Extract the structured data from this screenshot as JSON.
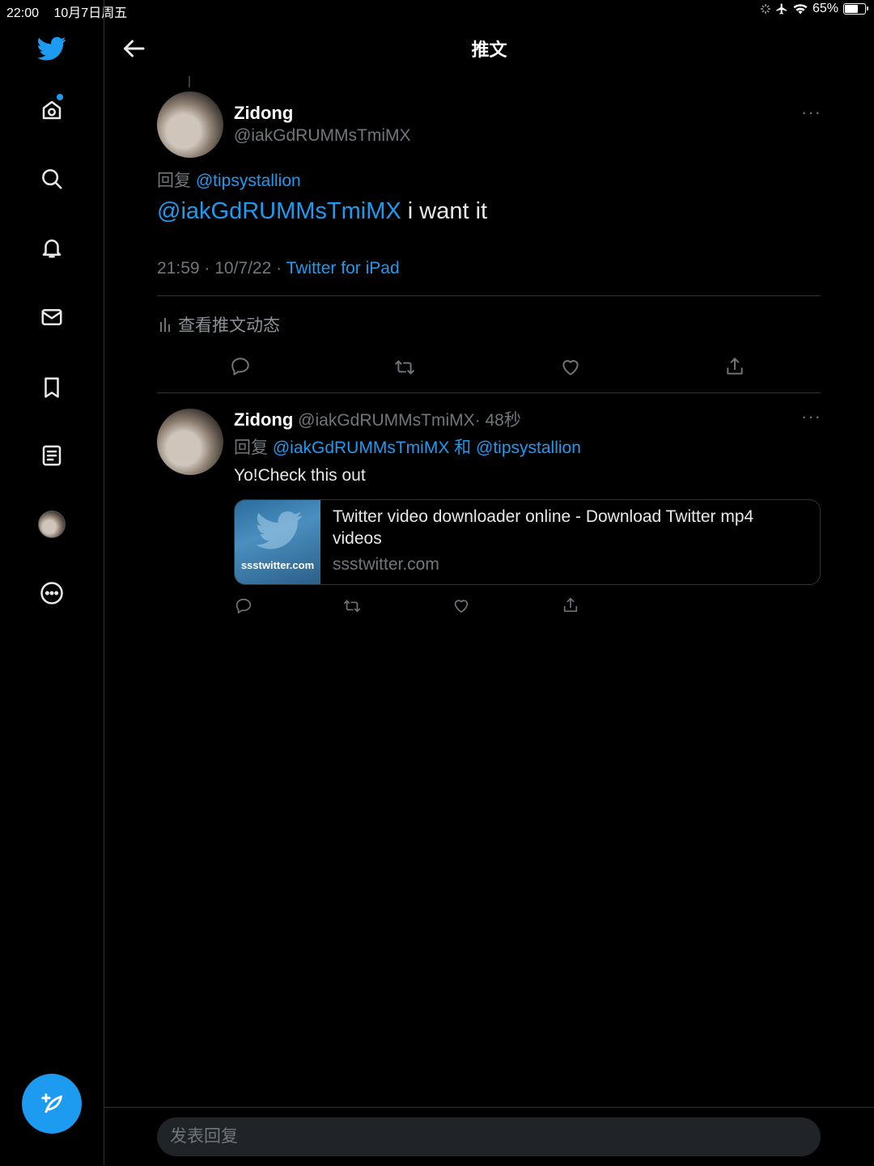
{
  "status_bar": {
    "time": "22:00",
    "date": "10月7日周五",
    "battery": "65%"
  },
  "header": {
    "title": "推文"
  },
  "main_tweet": {
    "name": "Zidong",
    "handle": "@iakGdRUMMsTmiMX",
    "reply_prefix": "回复",
    "reply_to": "@tipsystallion",
    "mention": "@iakGdRUMMsTmiMX",
    "text": " i want it",
    "timestamp": "21:59 · 10/7/22 ·",
    "source": "Twitter for iPad",
    "analytics_label": "查看推文动态"
  },
  "reply_tweet": {
    "name": "Zidong",
    "handle": "@iakGdRUMMsTmiMX",
    "time": "· 48秒",
    "reply_prefix": "回复",
    "reply_to_1": "@iakGdRUMMsTmiMX",
    "conjunction": "和",
    "reply_to_2": "@tipsystallion",
    "text": "Yo!Check this out",
    "card": {
      "title": "Twitter video downloader online - Download Twitter mp4 videos",
      "domain": "ssstwitter.com",
      "thumb_label": "ssstwitter.com"
    }
  },
  "reply_composer": {
    "placeholder": "发表回复"
  },
  "colors": {
    "accent": "#1d9bf0",
    "background": "#000000",
    "muted": "#71767b"
  }
}
